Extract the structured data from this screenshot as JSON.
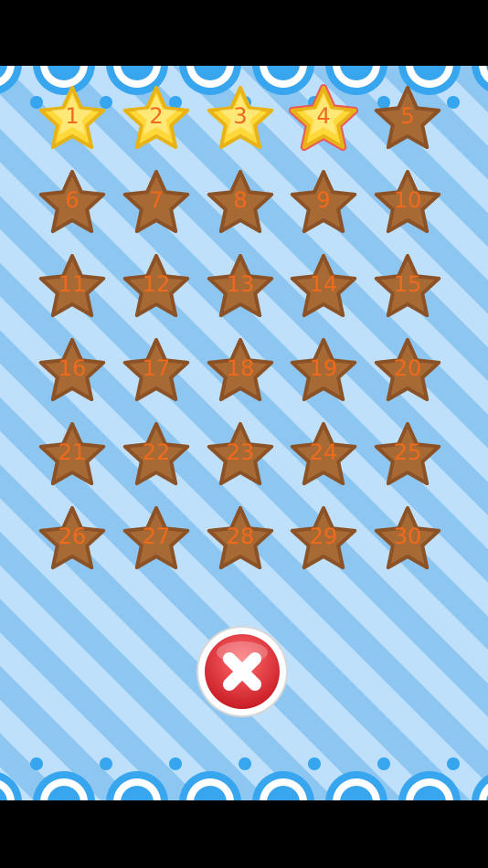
{
  "levels": [
    {
      "label": "1",
      "state": "unlocked"
    },
    {
      "label": "2",
      "state": "unlocked"
    },
    {
      "label": "3",
      "state": "unlocked"
    },
    {
      "label": "4",
      "state": "current"
    },
    {
      "label": "5",
      "state": "locked"
    },
    {
      "label": "6",
      "state": "locked"
    },
    {
      "label": "7",
      "state": "locked"
    },
    {
      "label": "8",
      "state": "locked"
    },
    {
      "label": "9",
      "state": "locked"
    },
    {
      "label": "10",
      "state": "locked"
    },
    {
      "label": "11",
      "state": "locked"
    },
    {
      "label": "12",
      "state": "locked"
    },
    {
      "label": "13",
      "state": "locked"
    },
    {
      "label": "14",
      "state": "locked"
    },
    {
      "label": "15",
      "state": "locked"
    },
    {
      "label": "16",
      "state": "locked"
    },
    {
      "label": "17",
      "state": "locked"
    },
    {
      "label": "18",
      "state": "locked"
    },
    {
      "label": "19",
      "state": "locked"
    },
    {
      "label": "20",
      "state": "locked"
    },
    {
      "label": "21",
      "state": "locked"
    },
    {
      "label": "22",
      "state": "locked"
    },
    {
      "label": "23",
      "state": "locked"
    },
    {
      "label": "24",
      "state": "locked"
    },
    {
      "label": "25",
      "state": "locked"
    },
    {
      "label": "26",
      "state": "locked"
    },
    {
      "label": "27",
      "state": "locked"
    },
    {
      "label": "28",
      "state": "locked"
    },
    {
      "label": "29",
      "state": "locked"
    },
    {
      "label": "30",
      "state": "locked"
    }
  ],
  "close_button": {
    "icon": "close-x-icon"
  },
  "colors": {
    "star_unlocked": "#ffd83a",
    "star_locked": "#a86a35",
    "star_current_outline": "#e8585c",
    "number_text": "#f06a1c",
    "close_red": "#e23a3f",
    "stripe_light": "#bfe0fb",
    "stripe_dark": "#8ec6f2",
    "deco_blue": "#37a6ee"
  }
}
